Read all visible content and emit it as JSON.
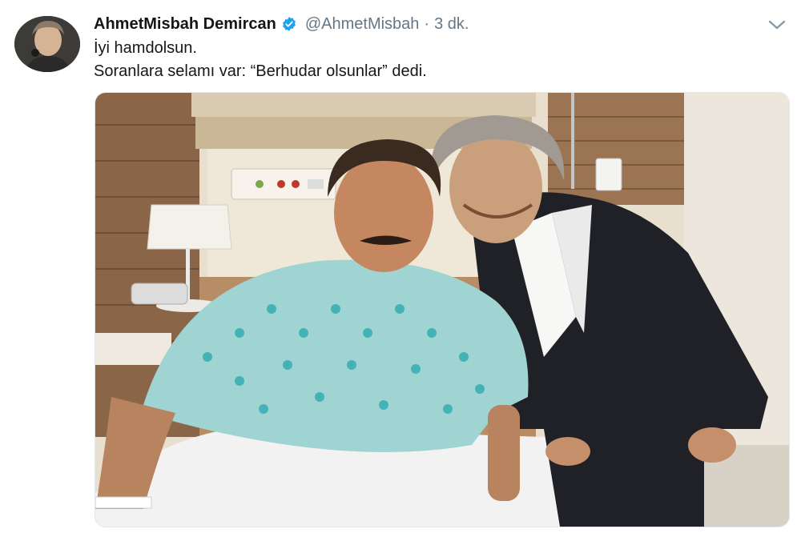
{
  "tweet": {
    "author_name": "AhmetMisbah Demircan",
    "handle": "@AhmetMisbah",
    "separator": "·",
    "time": "3 dk.",
    "lines": [
      "İyi hamdolsun.",
      "Soranlara selamı var: “Berhudar olsunlar” dedi."
    ]
  },
  "icons": {
    "verified": "verified-badge-icon",
    "menu": "chevron-down-icon"
  },
  "colors": {
    "verified": "#1da1f2",
    "secondary_text": "#657786",
    "primary_text": "#14171a"
  }
}
